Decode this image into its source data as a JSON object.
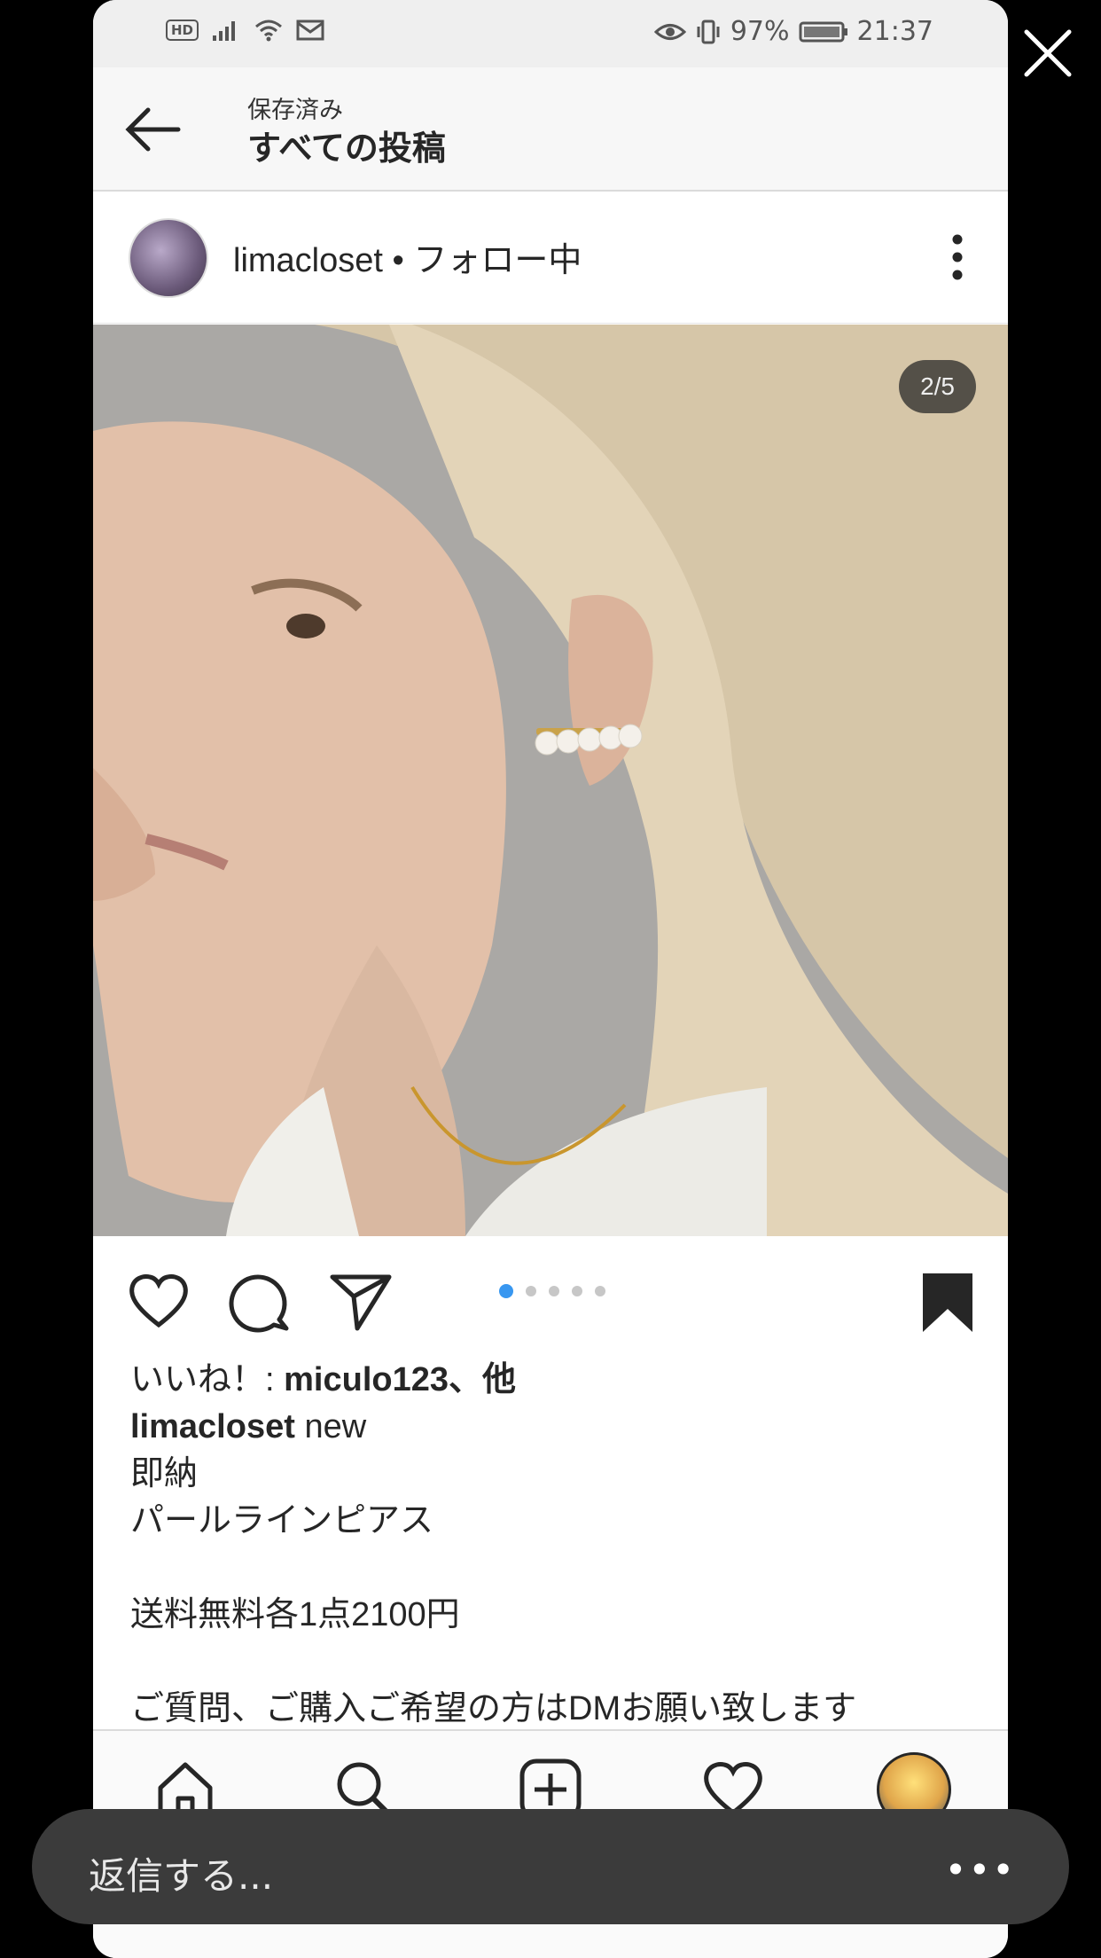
{
  "status_bar": {
    "hd": "HD",
    "battery": "97%",
    "time": "21:37"
  },
  "app_bar": {
    "subtitle": "保存済み",
    "title": "すべての投稿"
  },
  "post": {
    "username": "limacloset • フォロー中",
    "image_counter": "2/5",
    "carousel": {
      "total": 5,
      "active_index": 0
    },
    "likes_prefix": "いいね！: ",
    "likes_user": "miculo123",
    "likes_suffix": "、他",
    "caption_user": "limacloset",
    "caption_lines": [
      "new",
      "即納",
      "パールラインピアス",
      "",
      "送料無料各1点2100円",
      "",
      "ご質問、ご購入ご希望の方はDMお願い致します"
    ]
  },
  "reply": {
    "placeholder": "返信する...",
    "more": "•••"
  },
  "colors": {
    "accent": "#3897f0",
    "background": "#000000",
    "reply_bar": "#3b3b3b"
  },
  "icons": [
    "back-arrow-icon",
    "more-vertical-icon",
    "heart-icon",
    "comment-icon",
    "share-icon",
    "bookmark-icon",
    "home-icon",
    "search-icon",
    "add-post-icon",
    "activity-heart-icon",
    "profile-avatar",
    "close-icon"
  ]
}
